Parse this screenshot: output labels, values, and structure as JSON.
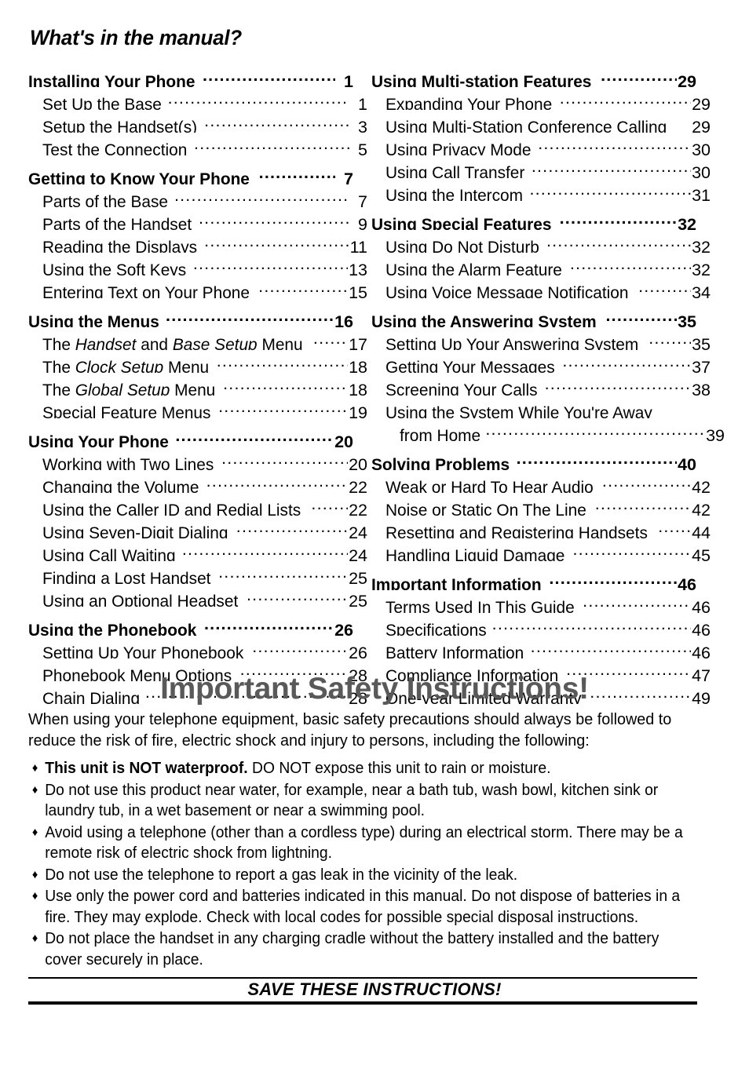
{
  "document": {
    "toc_heading": "What's in the manual?",
    "safety_heading": "Important Safety Instructions!",
    "safety_heading_color": "#595959",
    "safety_intro": "When using your telephone equipment, basic safety precautions should always be followed to reduce the risk of fire, electric shock and injury to persons, including the following:",
    "save_line": "SAVE THESE INSTRUCTIONS!",
    "bullet_glyph": "♦"
  },
  "toc": {
    "left_column": [
      {
        "type": "chapter",
        "label": "Installing Your Phone",
        "page": "1"
      },
      {
        "type": "section",
        "label": "Set Up the Base",
        "page": "1"
      },
      {
        "type": "section",
        "label": "Setup the Handset(s)",
        "page": "3"
      },
      {
        "type": "section",
        "label": "Test the Connection",
        "page": "5"
      },
      {
        "type": "chapter",
        "label": "Getting to Know Your Phone",
        "page": "7"
      },
      {
        "type": "section",
        "label": "Parts of the Base",
        "page": "7"
      },
      {
        "type": "section",
        "label": "Parts of the Handset",
        "page": "9"
      },
      {
        "type": "section",
        "label": "Reading the Displays ",
        "page": "11"
      },
      {
        "type": "section",
        "label": "Using the Soft Keys",
        "page": "13"
      },
      {
        "type": "section",
        "label": "Entering Text on Your Phone",
        "page": "15"
      },
      {
        "type": "chapter",
        "label": "Using the Menus",
        "page": "16"
      },
      {
        "type": "section",
        "label": "The <i>Handset</i> and <i>Base Setup</i> Menu",
        "page": "17",
        "html": true
      },
      {
        "type": "section",
        "label": "The <i>Clock Setup</i> Menu",
        "page": "18",
        "html": true
      },
      {
        "type": "section",
        "label": "The <i>Global Setup</i> Menu",
        "page": "18",
        "html": true
      },
      {
        "type": "section",
        "label": "Special Feature Menus",
        "page": "19"
      },
      {
        "type": "chapter",
        "label": "Using Your Phone",
        "page": "20"
      },
      {
        "type": "section",
        "label": "Working with Two Lines",
        "page": "20"
      },
      {
        "type": "section",
        "label": "Changing the Volume",
        "page": "22"
      },
      {
        "type": "section",
        "label": "Using the Caller ID and Redial Lists",
        "page": "22"
      },
      {
        "type": "section",
        "label": "Using Seven-Digit Dialing",
        "page": "24"
      },
      {
        "type": "section",
        "label": "Using Call Waiting",
        "page": "24"
      },
      {
        "type": "section",
        "label": "Finding a Lost Handset",
        "page": "25"
      },
      {
        "type": "section",
        "label": "Using an Optional Headset",
        "page": "25"
      },
      {
        "type": "chapter",
        "label": "Using the Phonebook",
        "page": "26"
      },
      {
        "type": "section",
        "label": "Setting Up Your Phonebook",
        "page": "26"
      },
      {
        "type": "section",
        "label": "Phonebook Menu Options",
        "page": "28"
      },
      {
        "type": "section",
        "label": "Chain Dialing",
        "page": "28"
      }
    ],
    "right_column": [
      {
        "type": "chapter",
        "label": "Using Multi-station Features",
        "page": "29"
      },
      {
        "type": "section",
        "label": "Expanding Your Phone",
        "page": "29"
      },
      {
        "type": "section",
        "label": "Using Multi-Station Conference Calling",
        "page": "29",
        "dots": false
      },
      {
        "type": "section",
        "label": "Using Privacy Mode",
        "page": "30"
      },
      {
        "type": "section",
        "label": "Using Call Transfer",
        "page": "30"
      },
      {
        "type": "section",
        "label": "Using the Intercom",
        "page": "31"
      },
      {
        "type": "chapter",
        "label": "Using Special Features",
        "page": "32"
      },
      {
        "type": "section",
        "label": "Using Do Not Disturb",
        "page": "32"
      },
      {
        "type": "section",
        "label": "Using the Alarm Feature",
        "page": "32"
      },
      {
        "type": "section",
        "label": "Using Voice Message Notification",
        "page": "34"
      },
      {
        "type": "chapter",
        "label": "Using the Answering System ",
        "page": "35"
      },
      {
        "type": "section",
        "label": "Setting Up Your Answering System",
        "page": "35"
      },
      {
        "type": "section",
        "label": "Getting Your Messages",
        "page": "37"
      },
      {
        "type": "section",
        "label": "Screening Your Calls",
        "page": "38"
      },
      {
        "type": "section",
        "label": "Using the System While You're Away",
        "page": "",
        "dots": false
      },
      {
        "type": "cont",
        "label": "from Home",
        "page": "39"
      },
      {
        "type": "chapter",
        "label": "Solving Problems",
        "page": "40"
      },
      {
        "type": "section",
        "label": "Weak or Hard To Hear Audio ",
        "page": "42"
      },
      {
        "type": "section",
        "label": "Noise or Static On The Line",
        "page": "42"
      },
      {
        "type": "section",
        "label": "Resetting and Registering Handsets",
        "page": "44"
      },
      {
        "type": "section",
        "label": "Handling Liquid Damage",
        "page": "45"
      },
      {
        "type": "chapter",
        "label": "Important Information",
        "page": "46"
      },
      {
        "type": "section",
        "label": "Terms Used In This Guide",
        "page": "46"
      },
      {
        "type": "section",
        "label": "Specifications",
        "page": "46"
      },
      {
        "type": "section",
        "label": "Battery Information",
        "page": "46"
      },
      {
        "type": "section",
        "label": "Compliance Information",
        "page": "47"
      },
      {
        "type": "section",
        "label": "One-year Limited Warranty",
        "page": "49"
      }
    ]
  },
  "safety_items": [
    {
      "html": "<b>This unit is NOT waterproof.</b> DO NOT expose this unit to rain or moisture."
    },
    {
      "html": "Do not use this product near water, for example, near a bath tub, wash bowl, kitchen sink or laundry tub, in a wet basement or near a swimming pool."
    },
    {
      "html": "Avoid using a telephone (other than a cordless type) during an electrical storm. There may be a remote risk of electric shock from lightning."
    },
    {
      "html": "Do not use the telephone to report a gas leak in the vicinity of the leak."
    },
    {
      "html": "Use only the power cord and batteries indicated in this manual. Do not dispose of batteries in a fire. They may explode. Check with local codes for possible special disposal instructions."
    },
    {
      "html": "Do not place the handset in any charging cradle without the battery installed and the battery cover securely in place."
    }
  ]
}
